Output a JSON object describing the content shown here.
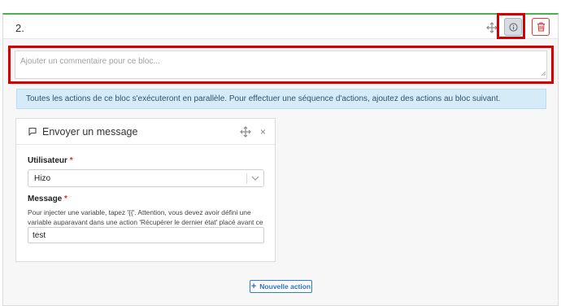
{
  "block": {
    "number": "2.",
    "comment_placeholder": "Ajouter un commentaire pour ce bloc...",
    "comment_value": "",
    "info_message": "Toutes les actions de ce bloc s'exécuteront en parallèle. Pour effectuer une séquence d'actions, ajoutez des actions au bloc suivant.",
    "icons": {
      "move": "move-icon",
      "info": "info-icon",
      "delete": "trash-icon"
    },
    "accent_color": "#4caf50",
    "highlight_color": "#d40000"
  },
  "action_card": {
    "title": "Envoyer un message",
    "icons": {
      "type": "message-flag-icon",
      "move": "move-icon",
      "close": "close-icon"
    },
    "close_glyph": "×",
    "user_field": {
      "label": "Utilisateur",
      "required_mark": "*",
      "selected_value": "Hizo"
    },
    "message_field": {
      "label": "Message",
      "required_mark": "*",
      "help_text": "Pour injecter une variable, tapez '{{'. Attention, vous devez avoir défini une variable auparavant dans une action 'Récupérer le dernier état' placé avant ce bloc message.",
      "value": "test"
    }
  },
  "new_action_button": {
    "label": "Nouvelle action",
    "plus": "+"
  }
}
